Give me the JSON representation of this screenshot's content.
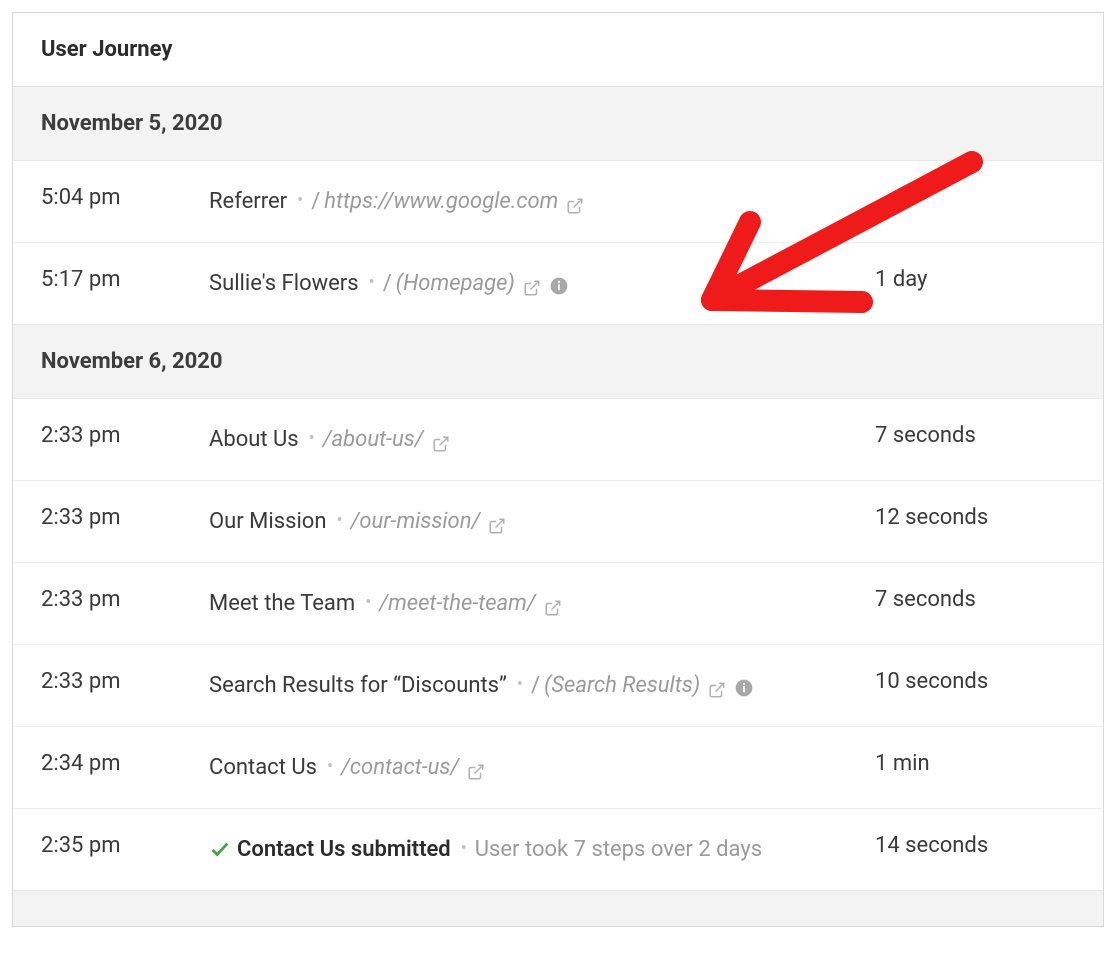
{
  "panel": {
    "title": "User Journey"
  },
  "groups": [
    {
      "date": "November 5, 2020",
      "entries": [
        {
          "time": "5:04 pm",
          "title": "Referrer",
          "path_slash": "/",
          "path": "https://www.google.com",
          "has_external": true,
          "has_info": false,
          "duration": ""
        },
        {
          "time": "5:17 pm",
          "title": "Sullie's Flowers",
          "path_slash": "/",
          "path": "(Homepage)",
          "has_external": true,
          "has_info": true,
          "duration": "1 day"
        }
      ]
    },
    {
      "date": "November 6, 2020",
      "entries": [
        {
          "time": "2:33 pm",
          "title": "About Us",
          "path_slash": "",
          "path": "/about-us/",
          "has_external": true,
          "has_info": false,
          "duration": "7 seconds"
        },
        {
          "time": "2:33 pm",
          "title": "Our Mission",
          "path_slash": "",
          "path": "/our-mission/",
          "has_external": true,
          "has_info": false,
          "duration": "12 seconds"
        },
        {
          "time": "2:33 pm",
          "title": "Meet the Team",
          "path_slash": "",
          "path": "/meet-the-team/",
          "has_external": true,
          "has_info": false,
          "duration": "7 seconds"
        },
        {
          "time": "2:33 pm",
          "title": "Search Results for “Discounts”",
          "path_slash": "/",
          "path": "(Search Results)",
          "has_external": true,
          "has_info": true,
          "duration": "10 seconds"
        },
        {
          "time": "2:34 pm",
          "title": "Contact Us",
          "path_slash": "",
          "path": "/contact-us/",
          "has_external": true,
          "has_info": false,
          "duration": "1 min"
        },
        {
          "time": "2:35 pm",
          "title": "Contact Us submitted",
          "is_submission": true,
          "meta": "User took 7 steps over 2 days",
          "duration": "14 seconds"
        }
      ]
    }
  ],
  "annotation": {
    "color": "#ef1a1a"
  }
}
